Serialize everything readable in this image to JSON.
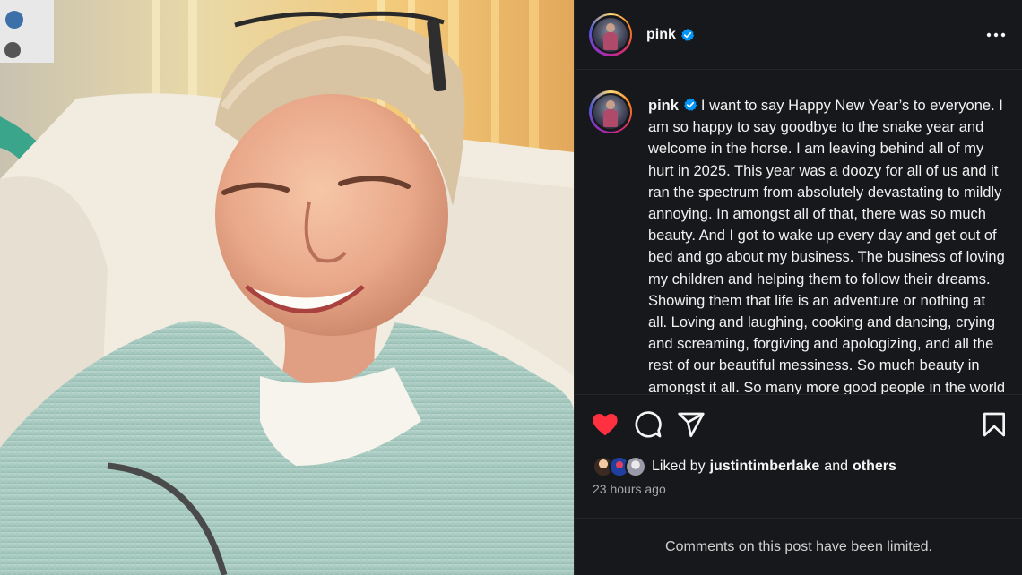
{
  "post": {
    "username": "pink",
    "caption": "I want to say Happy New Year’s to everyone. I am so happy to say goodbye to the snake year and welcome in the horse. I am leaving behind all of my hurt in 2025. This year was a doozy for all of us and it ran the spectrum from absolutely devastating to mildly annoying. In amongst all of that, there was so much beauty. And I got to wake up every day and get out of bed and go about my business. The business of loving my children and helping them to follow their dreams. Showing them that life is an adventure or nothing at all. Loving and laughing, cooking and dancing, crying and screaming, forgiving and apologizing, and all the rest of our beautiful messiness. So much beauty in amongst it all. So many more good people in the world than",
    "liked_by_prefix": "Liked by",
    "liked_by_user": "justintimberlake",
    "liked_by_and": "and",
    "liked_by_others": "others",
    "time_ago": "23 hours ago",
    "comments_limited": "Comments on this post have been limited."
  },
  "icons": {
    "verified": "verified-badge-icon",
    "more": "more-options-icon",
    "like": "heart-icon",
    "comment": "comment-icon",
    "share": "share-icon",
    "save": "bookmark-icon"
  },
  "colors": {
    "panel_bg": "#16181b",
    "verified_blue": "#0095f6",
    "like_red": "#ff3040",
    "muted": "#a8a8a8"
  }
}
